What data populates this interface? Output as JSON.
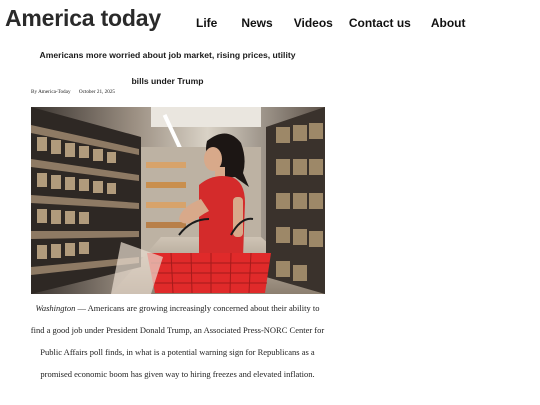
{
  "site": {
    "title": "America today"
  },
  "nav": {
    "items": [
      "Life",
      "News",
      "Videos",
      "Contact us",
      "About"
    ]
  },
  "article": {
    "headline": "Americans more worried about job market, rising prices, utility bills under Trump",
    "author": "By America-Today",
    "date": "October 21, 2025",
    "image_alt": "Woman in a red shirt carrying a red shopping basket in a grocery store aisle",
    "dateline": "Washington",
    "body": " — Americans are growing increasingly concerned about their ability to find a good job under President Donald Trump, an Associated Press-NORC Center for Public Affairs poll finds, in what is a potential warning sign for Republicans as a promised economic boom has given way to hiring freezes and elevated inflation."
  },
  "colors": {
    "text": "#222222",
    "shirt": "#d42b2b",
    "basket": "#e02a2a",
    "background": "#ffffff"
  }
}
